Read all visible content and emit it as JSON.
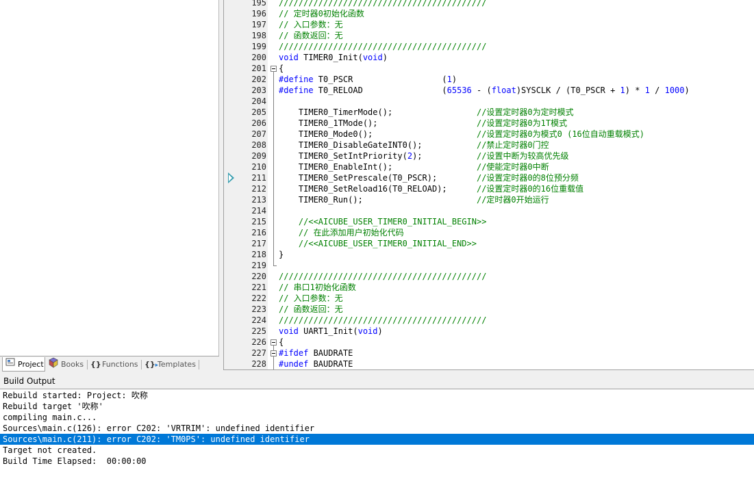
{
  "sidebar_tabs": [
    {
      "label": "Project",
      "icon": "project-icon",
      "active": true
    },
    {
      "label": "Books",
      "icon": "books-icon",
      "active": false
    },
    {
      "label": "Functions",
      "icon": "functions-icon",
      "active": false
    },
    {
      "label": "Templates",
      "icon": "templates-icon",
      "active": false
    }
  ],
  "editor": {
    "lines": [
      {
        "n": "195",
        "t": "//////////////////////////////////////////",
        "cls": "c"
      },
      {
        "n": "196",
        "t": "// 定时器0初始化函数",
        "cls": "c"
      },
      {
        "n": "197",
        "t": "// 入口参数：无",
        "cls": "c"
      },
      {
        "n": "198",
        "t": "// 函数返回：无",
        "cls": "c"
      },
      {
        "n": "199",
        "t": "//////////////////////////////////////////",
        "cls": "c"
      },
      {
        "n": "200",
        "parts": [
          [
            "void",
            "k"
          ],
          [
            " TIMER0_Init(",
            ""
          ],
          [
            "void",
            "k"
          ],
          [
            ")",
            ""
          ]
        ]
      },
      {
        "n": "201",
        "t": "{"
      },
      {
        "n": "202",
        "parts": [
          [
            "#define",
            "p"
          ],
          [
            " T0_PSCR                  ",
            ""
          ],
          [
            "(",
            ""
          ],
          [
            "1",
            "n"
          ],
          [
            ")",
            ""
          ]
        ]
      },
      {
        "n": "203",
        "parts": [
          [
            "#define",
            "p"
          ],
          [
            " T0_RELOAD                ",
            ""
          ],
          [
            "(",
            ""
          ],
          [
            "65536",
            "n"
          ],
          [
            " - (",
            ""
          ],
          [
            "float",
            "k"
          ],
          [
            ")SYSCLK / (T0_PSCR + ",
            ""
          ],
          [
            "1",
            "n"
          ],
          [
            ") * ",
            ""
          ],
          [
            "1",
            "n"
          ],
          [
            " / ",
            ""
          ],
          [
            "1000",
            "n"
          ],
          [
            ")",
            ""
          ]
        ]
      },
      {
        "n": "204",
        "t": ""
      },
      {
        "n": "205",
        "parts": [
          [
            "    TIMER0_TimerMode();                 ",
            ""
          ],
          [
            "//设置定时器0为定时模式",
            "c"
          ]
        ]
      },
      {
        "n": "206",
        "parts": [
          [
            "    TIMER0_1TMode();                    ",
            ""
          ],
          [
            "//设置定时器0为1T模式",
            "c"
          ]
        ]
      },
      {
        "n": "207",
        "parts": [
          [
            "    TIMER0_Mode0();                     ",
            ""
          ],
          [
            "//设置定时器0为模式0 (16位自动重载模式)",
            "c"
          ]
        ]
      },
      {
        "n": "208",
        "parts": [
          [
            "    TIMER0_DisableGateINT0();           ",
            ""
          ],
          [
            "//禁止定时器0门控",
            "c"
          ]
        ]
      },
      {
        "n": "209",
        "parts": [
          [
            "    TIMER0_SetIntPriority(",
            ""
          ],
          [
            "2",
            "n"
          ],
          [
            ");           ",
            ""
          ],
          [
            "//设置中断为较高优先级",
            "c"
          ]
        ]
      },
      {
        "n": "210",
        "parts": [
          [
            "    TIMER0_EnableInt();                 ",
            ""
          ],
          [
            "//使能定时器0中断",
            "c"
          ]
        ]
      },
      {
        "n": "211",
        "parts": [
          [
            "    TIMER0_SetPrescale(T0_PSCR);        ",
            ""
          ],
          [
            "//设置定时器0的8位预分频",
            "c"
          ]
        ]
      },
      {
        "n": "212",
        "parts": [
          [
            "    TIMER0_SetReload16(T0_RELOAD);      ",
            ""
          ],
          [
            "//设置定时器0的16位重载值",
            "c"
          ]
        ]
      },
      {
        "n": "213",
        "parts": [
          [
            "    TIMER0_Run();                       ",
            ""
          ],
          [
            "//定时器0开始运行",
            "c"
          ]
        ]
      },
      {
        "n": "214",
        "t": ""
      },
      {
        "n": "215",
        "t": "    //<<AICUBE_USER_TIMER0_INITIAL_BEGIN>>",
        "cls": "c"
      },
      {
        "n": "216",
        "t": "    // 在此添加用户初始化代码",
        "cls": "c"
      },
      {
        "n": "217",
        "t": "    //<<AICUBE_USER_TIMER0_INITIAL_END>>",
        "cls": "c"
      },
      {
        "n": "218",
        "t": "}"
      },
      {
        "n": "219",
        "t": ""
      },
      {
        "n": "220",
        "t": "//////////////////////////////////////////",
        "cls": "c"
      },
      {
        "n": "221",
        "t": "// 串口1初始化函数",
        "cls": "c"
      },
      {
        "n": "222",
        "t": "// 入口参数：无",
        "cls": "c"
      },
      {
        "n": "223",
        "t": "// 函数返回：无",
        "cls": "c"
      },
      {
        "n": "224",
        "t": "//////////////////////////////////////////",
        "cls": "c"
      },
      {
        "n": "225",
        "parts": [
          [
            "void",
            "k"
          ],
          [
            " UART1_Init(",
            ""
          ],
          [
            "void",
            "k"
          ],
          [
            ")",
            ""
          ]
        ]
      },
      {
        "n": "226",
        "t": "{"
      },
      {
        "n": "227",
        "parts": [
          [
            "#ifdef",
            "p"
          ],
          [
            " BAUDRATE",
            ""
          ]
        ]
      },
      {
        "n": "228",
        "parts": [
          [
            "#undef",
            "p"
          ],
          [
            " BAUDRATE",
            ""
          ]
        ]
      }
    ]
  },
  "build_output": {
    "title": "Build Output",
    "lines": [
      {
        "t": "Rebuild started: Project: 吹称"
      },
      {
        "t": "Rebuild target '吹称'"
      },
      {
        "t": "compiling main.c..."
      },
      {
        "t": "Sources\\main.c(126): error C202: 'VRTRIM': undefined identifier"
      },
      {
        "t": "Sources\\main.c(211): error C202: 'TM0PS': undefined identifier",
        "selected": true
      },
      {
        "t": "Target not created."
      },
      {
        "t": "Build Time Elapsed:  00:00:00"
      }
    ]
  },
  "colors": {
    "selection": "#0078d7",
    "keyword": "#0000ff",
    "comment": "#008000"
  }
}
